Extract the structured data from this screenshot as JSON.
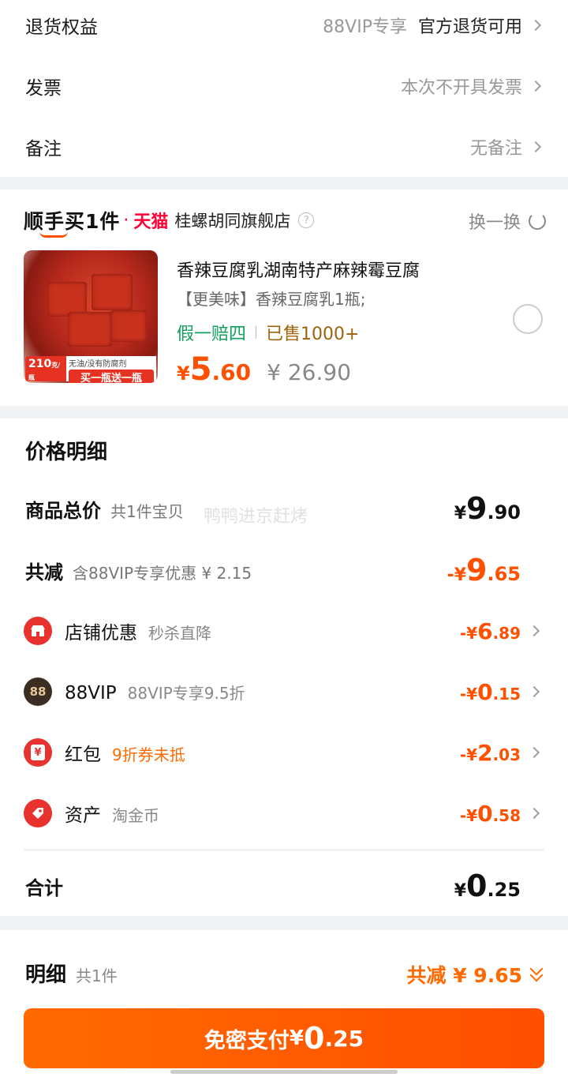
{
  "services": {
    "return": {
      "label": "退货权益",
      "vip": "88VIP专享",
      "value": "官方退货可用"
    },
    "invoice": {
      "label": "发票",
      "value": "本次不开具发票"
    },
    "note": {
      "label": "备注",
      "value": "无备注"
    }
  },
  "addon": {
    "brand": "顺手买1件",
    "platform": "天猫",
    "store": "桂螺胡同旗舰店",
    "help": "?",
    "swap": "换一换",
    "product": {
      "image_badge_num": "210",
      "image_badge_unit": "克/瓶",
      "image_badge_note": "无油/没有防腐剂",
      "image_badge_promo": "买一瓶送一瓶",
      "title": "香辣豆腐乳湖南特产麻辣霉豆腐",
      "sku": "【更美味】香辣豆腐乳1瓶;",
      "tag_guarantee": "假一赔四",
      "tag_sold": "已售1000+",
      "price_currency": "¥",
      "price_int": "5",
      "price_dec": ".60",
      "orig_price": "¥ 26.90"
    }
  },
  "detail": {
    "title": "价格明细",
    "watermark": "鸭鸭进京赶烤",
    "total": {
      "label": "商品总价",
      "sub": "共1件宝贝",
      "cur": "¥",
      "int": "9",
      "dec": ".90"
    },
    "reduce": {
      "label": "共减",
      "sub": "含88VIP专享优惠 ¥ 2.15",
      "cur": "-¥",
      "int": "9",
      "dec": ".65"
    },
    "items": [
      {
        "name": "店铺优惠",
        "sub": "秒杀直降",
        "cur": "-¥",
        "int": "6",
        "dec": ".89",
        "color": "#e8322e"
      },
      {
        "name": "88VIP",
        "sub": "88VIP专享9.5折",
        "cur": "-¥",
        "int": "0",
        "dec": ".15",
        "color": "#3a2d22",
        "glyph": "88"
      },
      {
        "name": "红包",
        "sub": "9折券未抵",
        "cur": "-¥",
        "int": "2",
        "dec": ".03",
        "color": "#e8322e",
        "glyph": "¥"
      },
      {
        "name": "资产",
        "sub": "淘金币",
        "cur": "-¥",
        "int": "0",
        "dec": ".58",
        "color": "#e8322e"
      }
    ],
    "sum": {
      "label": "合计",
      "cur": "¥",
      "int": "0",
      "dec": ".25"
    }
  },
  "footer": {
    "title": "明细",
    "sub": "共1件",
    "save": "共减 ¥ 9.65",
    "pay_label": "免密支付",
    "pay_cur": "¥",
    "pay_int": "0",
    "pay_dec": ".25"
  }
}
